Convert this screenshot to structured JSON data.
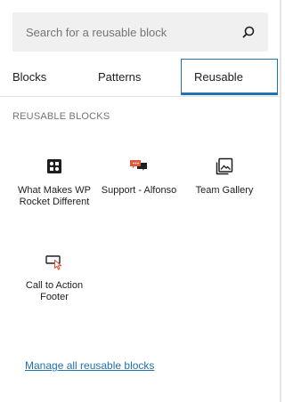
{
  "search": {
    "placeholder": "Search for a reusable block",
    "icon": "search-icon"
  },
  "tabs": [
    {
      "label": "Blocks"
    },
    {
      "label": "Patterns"
    },
    {
      "label": "Reusable",
      "active": true
    }
  ],
  "section": {
    "title": "REUSABLE BLOCKS"
  },
  "blocks": [
    {
      "label": "What Makes WP Rocket Different",
      "icon": "block-grid-icon"
    },
    {
      "label": "Support - Alfonso",
      "icon": "chat-bubbles-icon"
    },
    {
      "label": "Team Gallery",
      "icon": "gallery-icon"
    },
    {
      "label": "Call to Action Footer",
      "icon": "call-to-action-icon"
    }
  ],
  "footer": {
    "manage_link": "Manage all reusable blocks"
  },
  "colors": {
    "accent": "#2271b1",
    "search_bg": "#f0f0f0",
    "chat_orange": "#e0573f"
  }
}
